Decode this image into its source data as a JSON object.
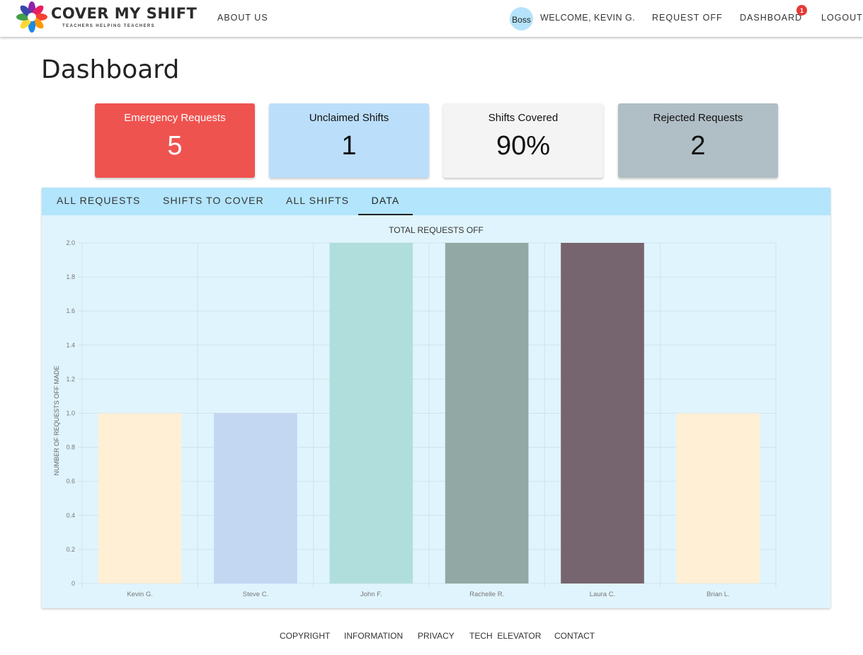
{
  "nav": {
    "brand": "COVER MY SHIFT",
    "tagline": "TEACHERS HELPING TEACHERS",
    "about_us": "ABOUT US",
    "avatar_label": "Boss",
    "welcome": "WELCOME, KEVIN G.",
    "request_off": "REQUEST OFF",
    "dashboard": "DASHBOARD",
    "dashboard_badge": "1",
    "logout": "LOGOUT"
  },
  "page": {
    "title": "Dashboard"
  },
  "stats": [
    {
      "label": "Emergency Requests",
      "value": "5",
      "color": "#ef5350"
    },
    {
      "label": "Unclaimed Shifts",
      "value": "1",
      "color": "#bbdefb"
    },
    {
      "label": "Shifts Covered",
      "value": "90%",
      "color": "#f4f4f4"
    },
    {
      "label": "Rejected Requests",
      "value": "2",
      "color": "#b0bec5"
    }
  ],
  "tabs": [
    {
      "label": "ALL REQUESTS",
      "active": false
    },
    {
      "label": "SHIFTS TO COVER",
      "active": false
    },
    {
      "label": "ALL SHIFTS",
      "active": false
    },
    {
      "label": "DATA",
      "active": true
    }
  ],
  "chart_data": {
    "type": "bar",
    "title": "TOTAL REQUESTS OFF",
    "xlabel": "",
    "ylabel": "NUMBER OF REQUESTS OFF MADE",
    "categories": [
      "Kevin G.",
      "Steve C.",
      "John F.",
      "Rachelle R.",
      "Laura C.",
      "Brian L."
    ],
    "values": [
      1,
      1,
      2,
      2,
      2,
      1
    ],
    "colors": [
      "#ffefd5",
      "#c3d6f2",
      "#b0dedd",
      "#92a8a4",
      "#76646e",
      "#ffefd5"
    ],
    "ylim": [
      0,
      2
    ],
    "yticks": [
      0,
      0.2,
      0.4,
      0.6,
      0.8,
      1.0,
      1.2,
      1.4,
      1.6,
      1.8,
      2.0
    ],
    "ytick_labels": [
      "0",
      "0.2",
      "0.4",
      "0.6",
      "0.8",
      "1.0",
      "1.2",
      "1.4",
      "1.6",
      "1.8",
      "2.0"
    ],
    "grid": true,
    "legend": "none"
  },
  "footer": {
    "links": [
      "COPYRIGHT",
      "INFORMATION",
      "PRIVACY",
      "TECH  ELEVATOR",
      "CONTACT"
    ]
  }
}
